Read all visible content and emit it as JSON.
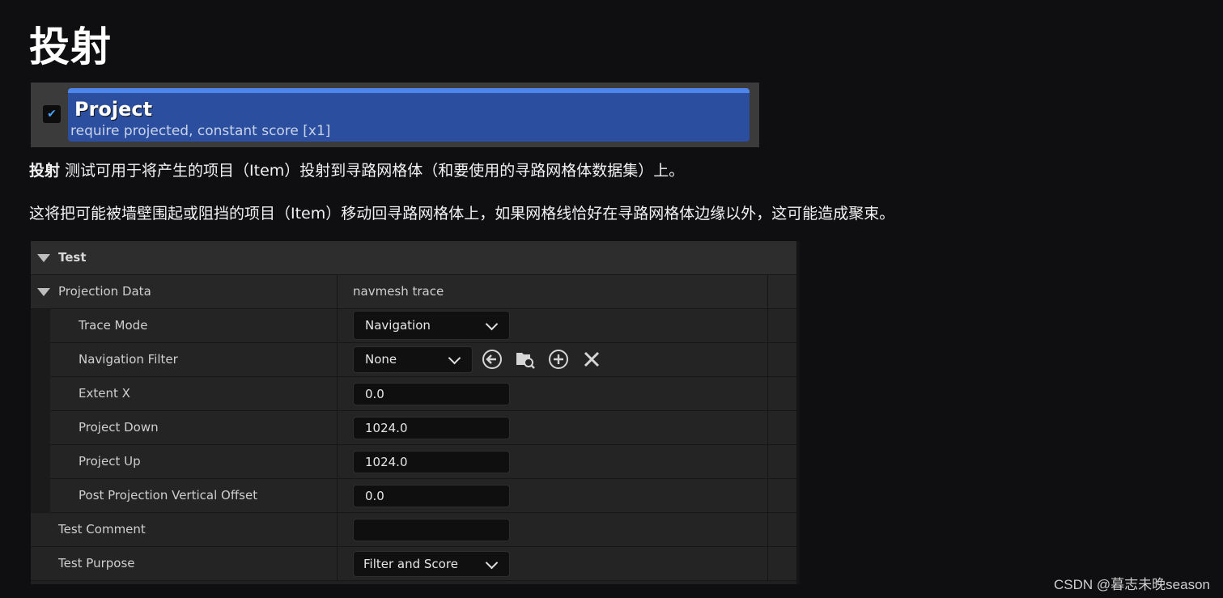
{
  "heading": "投射",
  "project_node": {
    "title": "Project",
    "subtitle": "require projected, constant score [x1]",
    "checked": true,
    "accent": "#2b4f9e"
  },
  "paragraphs": {
    "p1_bold": "投射",
    "p1_rest": " 测试可用于将产生的项目（Item）投射到寻路网格体（和要使用的寻路网格体数据集）上。",
    "p2": "这将把可能被墙壁围起或阻挡的项目（Item）移动回寻路网格体上，如果网格线恰好在寻路网格体边缘以外，这可能造成聚束。"
  },
  "details": {
    "section": "Test",
    "projection_data": {
      "label": "Projection Data",
      "value": "navmesh trace"
    },
    "trace_mode": {
      "label": "Trace Mode",
      "value": "Navigation"
    },
    "navigation_filter": {
      "label": "Navigation Filter",
      "value": "None"
    },
    "extent_x": {
      "label": "Extent X",
      "value": "0.0"
    },
    "project_down": {
      "label": "Project Down",
      "value": "1024.0"
    },
    "project_up": {
      "label": "Project Up",
      "value": "1024.0"
    },
    "post_offset": {
      "label": "Post Projection Vertical Offset",
      "value": "0.0"
    },
    "test_comment": {
      "label": "Test Comment",
      "value": ""
    },
    "test_purpose": {
      "label": "Test Purpose",
      "value": "Filter and Score"
    }
  },
  "icons": [
    "back-arrow-icon",
    "browse-folder-icon",
    "add-icon",
    "clear-icon"
  ],
  "watermark": "CSDN @暮志未晚season"
}
